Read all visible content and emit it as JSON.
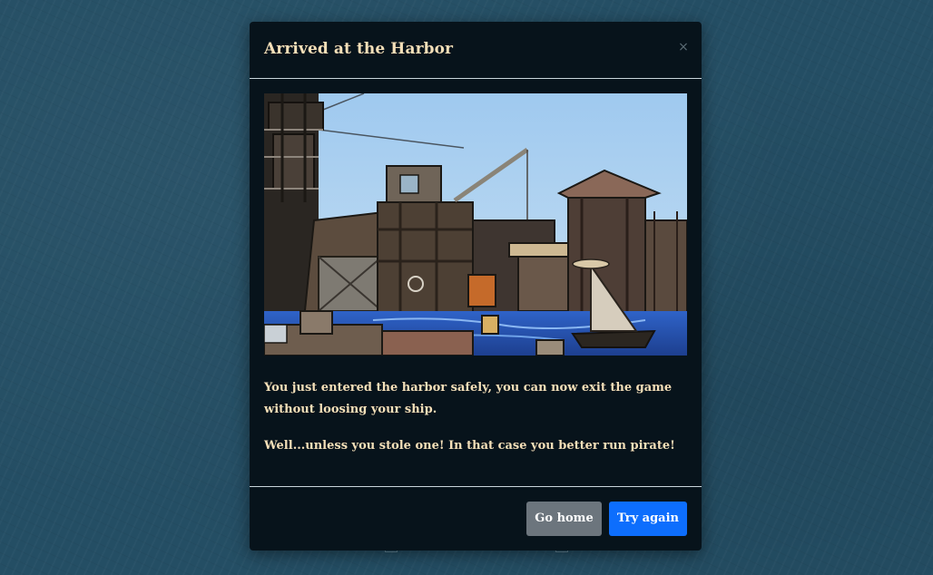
{
  "modal": {
    "title": "Arrived at the Harbor",
    "close_icon": "×",
    "image_subject": "harbor-town-icon",
    "message_1": "You just entered the harbor safely, you can now exit the game without loosing your ship.",
    "message_2": "Well...unless you stole one! In that case you better run pirate!",
    "buttons": {
      "go_home": "Go home",
      "try_again": "Try again"
    }
  },
  "colors": {
    "background": "#244e64",
    "modal_bg": "#07131b",
    "text": "#f4dfb8",
    "secondary_button": "#6c757d",
    "primary_button": "#0d6efd"
  }
}
